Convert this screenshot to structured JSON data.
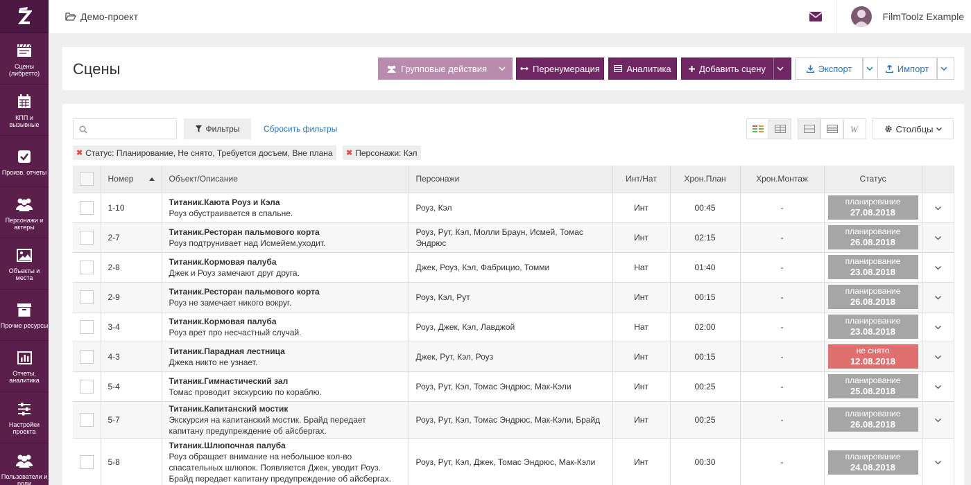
{
  "sidebar": {
    "items": [
      {
        "label": "Сцены (либретто)",
        "icon": "clapperboard-icon"
      },
      {
        "label": "КПП и вызывные",
        "icon": "calendar-icon"
      },
      {
        "label": "Произв. отчеты",
        "icon": "checkbox-icon"
      },
      {
        "label": "Персонажи и актеры",
        "icon": "users-icon"
      },
      {
        "label": "Объекты и места",
        "icon": "image-icon"
      },
      {
        "label": "Прочие ресурсы",
        "icon": "archive-icon"
      },
      {
        "label": "Отчеты, аналитика",
        "icon": "bar-chart-icon"
      },
      {
        "label": "Настройки проекта",
        "icon": "sliders-icon"
      },
      {
        "label": "Пользователи и роли",
        "icon": "user-group-icon"
      }
    ]
  },
  "topbar": {
    "project": "Демо-проект",
    "user": "FilmToolz Example"
  },
  "header": {
    "title": "Сцены",
    "buttons": {
      "group": "Групповые действия",
      "renumber": "Перенумерация",
      "analytics": "Аналитика",
      "add": "Добавить сцену",
      "export": "Экспорт",
      "import": "Импорт"
    }
  },
  "filters": {
    "search_placeholder": "",
    "filter_label": "Фильтры",
    "reset_label": "Сбросить фильтры",
    "columns_label": "Столбцы",
    "tags": [
      "Статус:  Планирование, Не снято, Требуется досъем, Вне плана",
      "Персонажи:  Кэл"
    ]
  },
  "table": {
    "headers": [
      "Номер",
      "Объект/Описание",
      "Персонажи",
      "Инт/Нат",
      "Хрон.План",
      "Хрон.Монтаж",
      "Статус"
    ],
    "rows": [
      {
        "num": "1-10",
        "obj": "Титаник.Каюта Роуз и Кэла",
        "desc": "Роуз обустраивается в спальне.",
        "chars": "Роуз, Кэл",
        "int": "Инт",
        "plan": "00:45",
        "mont": "-",
        "status": "планирование",
        "date": "27.08.2018",
        "st": "plan"
      },
      {
        "num": "2-7",
        "obj": "Титаник.Ресторан пальмового корта",
        "desc": "Роуз подтрунивает над Исмейем,уходит.",
        "chars": "Роуз, Рут, Кэл, Молли Браун, Исмей, Томас Эндрюс",
        "int": "Инт",
        "plan": "02:15",
        "mont": "-",
        "status": "планирование",
        "date": "26.08.2018",
        "st": "plan"
      },
      {
        "num": "2-8",
        "obj": "Титаник.Кормовая палуба",
        "desc": "Джек и Роуз замечают друг друга.",
        "chars": "Джек, Роуз, Кэл, Фабрицио, Томми",
        "int": "Нат",
        "plan": "01:40",
        "mont": "-",
        "status": "планирование",
        "date": "23.08.2018",
        "st": "plan"
      },
      {
        "num": "2-9",
        "obj": "Титаник.Ресторан пальмового корта",
        "desc": "Роуз не замечает никого вокруг.",
        "chars": "Роуз, Кэл, Рут",
        "int": "Инт",
        "plan": "00:15",
        "mont": "-",
        "status": "планирование",
        "date": "26.08.2018",
        "st": "plan"
      },
      {
        "num": "3-4",
        "obj": "Титаник.Кормовая палуба",
        "desc": "Роуз врет про несчастный случай.",
        "chars": "Роуз, Джек, Кэл, Лавджой",
        "int": "Нат",
        "plan": "02:00",
        "mont": "-",
        "status": "планирование",
        "date": "23.08.2018",
        "st": "plan"
      },
      {
        "num": "4-3",
        "obj": "Титаник.Парадная лестница",
        "desc": "Джека никто не узнает.",
        "chars": "Джек, Рут, Кэл, Роуз",
        "int": "Инт",
        "plan": "00:15",
        "mont": "-",
        "status": "не снято",
        "date": "12.08.2018",
        "st": "not"
      },
      {
        "num": "5-4",
        "obj": "Титаник.Гимнастический зал",
        "desc": "Томас проводит экскурсию по кораблю.",
        "chars": "Роуз, Рут, Кэл, Томас Эндрюс, Мак-Кэли",
        "int": "Инт",
        "plan": "00:25",
        "mont": "-",
        "status": "планирование",
        "date": "25.08.2018",
        "st": "plan"
      },
      {
        "num": "5-7",
        "obj": "Титаник.Капитанский мостик",
        "desc": "Экскурсия на капитанский мостик. Брайд передает капитану предупреждение об айсбергах.",
        "chars": "Роуз, Рут, Кэл, Томас Эндрюс, Мак-Кэли, Брайд",
        "int": "Инт",
        "plan": "00:25",
        "mont": "-",
        "status": "планирование",
        "date": "26.08.2018",
        "st": "plan"
      },
      {
        "num": "5-8",
        "obj": "Титаник.Шлюпочная палуба",
        "desc": "Роуз обращает внимание на небольшое кол-во спасательных шлюпок. Появляется Джек, уводит Роуз. Брайд передает капитану предупреждение об айсбергах.",
        "chars": "Роуз, Рут, Кэл, Джек, Томас Эндрюс, Мак-Кэли",
        "int": "Инт",
        "plan": "00:30",
        "mont": "-",
        "status": "планирование",
        "date": "24.08.2018",
        "st": "plan"
      }
    ]
  },
  "colors": {
    "brand": "#5b1f4c",
    "plan": "#a6a6a6",
    "not": "#e07070"
  }
}
